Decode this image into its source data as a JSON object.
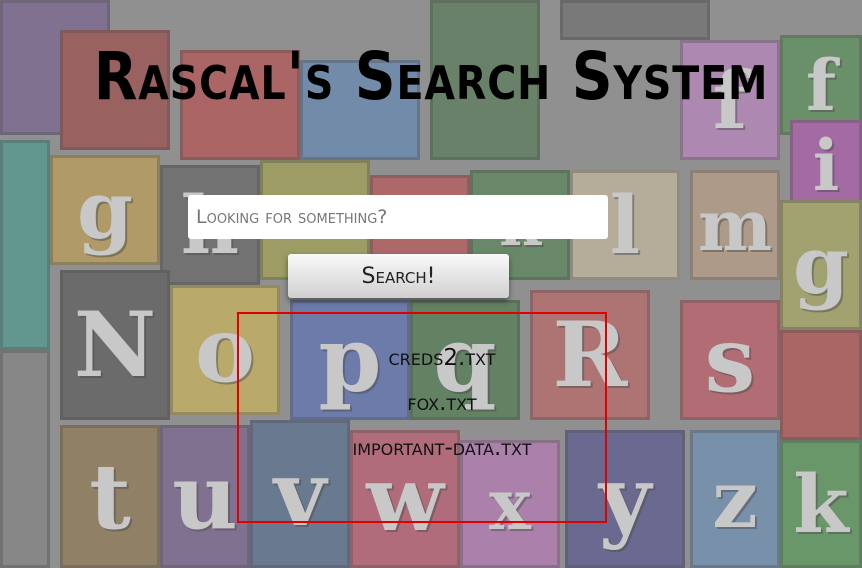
{
  "page": {
    "title": "Rascal's Search System"
  },
  "search": {
    "placeholder": "Looking for something?",
    "value": "",
    "button_label": "Search!"
  },
  "results": [
    "creds2.txt",
    "fox.txt",
    "important-data.txt"
  ],
  "background_letters": [
    "f",
    "g",
    "h",
    "l",
    "m",
    "g",
    "i",
    "f",
    "N",
    "o",
    "p",
    "q",
    "R",
    "s",
    "t",
    "u",
    "v",
    "w",
    "x",
    "y",
    "z",
    "k"
  ],
  "colors": {
    "results_border": "#e00000",
    "input_background": "#ffffff",
    "title_text": "#000000"
  }
}
